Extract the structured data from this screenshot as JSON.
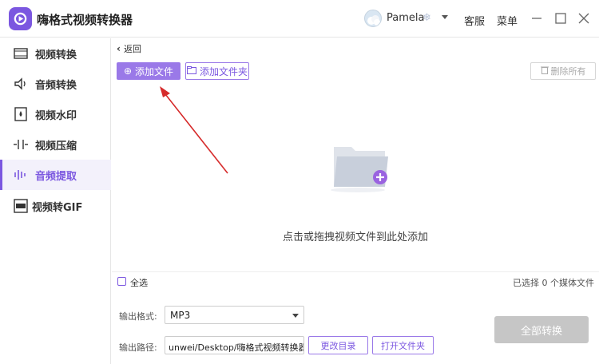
{
  "app": {
    "title": "嗨格式视频转换器"
  },
  "user": {
    "name": "Pamela"
  },
  "topbar": {
    "service": "客服",
    "menu": "菜单"
  },
  "sidebar": {
    "items": [
      {
        "label": "视频转换",
        "icon": "video-convert-icon"
      },
      {
        "label": "音频转换",
        "icon": "audio-convert-icon"
      },
      {
        "label": "视频水印",
        "icon": "watermark-icon"
      },
      {
        "label": "视频压缩",
        "icon": "compress-icon"
      },
      {
        "label": "音频提取",
        "icon": "audio-extract-icon",
        "active": true
      },
      {
        "label": "视频转GIF",
        "icon": "gif-icon"
      }
    ]
  },
  "main": {
    "back": "返回",
    "add_file": "添加文件",
    "add_folder": "添加文件夹",
    "delete_all": "删除所有",
    "drop_hint": "点击或拖拽视频文件到此处添加",
    "select_all": "全选",
    "selected_info": "已选择 0 个媒体文件"
  },
  "output": {
    "format_label": "输出格式:",
    "format_value": "MP3",
    "path_label": "输出路径:",
    "path_value": "unwei/Desktop/嗨格式视频转换器",
    "change_dir": "更改目录",
    "open_folder": "打开文件夹",
    "convert_all": "全部转换"
  },
  "colors": {
    "accent": "#7b57e0",
    "arrow": "#d62b2b",
    "disabled": "#c6c6c6"
  }
}
